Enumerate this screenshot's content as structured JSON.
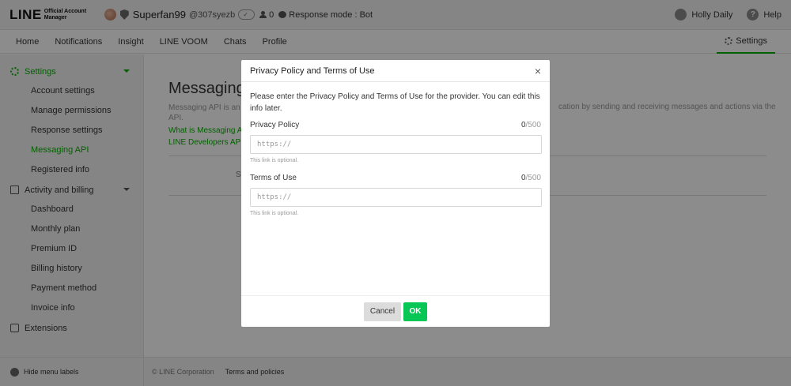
{
  "header": {
    "logo_main": "LINE",
    "logo_sub": "Official Account Manager",
    "account_name": "Superfan99",
    "account_id": "@307syezb",
    "badge": " ",
    "friends_count": "0",
    "response_mode": "Response mode : Bot",
    "user_name": "Holly Daily",
    "help_label": "Help"
  },
  "nav": {
    "tabs": [
      {
        "label": "Home"
      },
      {
        "label": "Notifications"
      },
      {
        "label": "Insight"
      },
      {
        "label": "LINE VOOM"
      },
      {
        "label": "Chats"
      },
      {
        "label": "Profile"
      }
    ],
    "settings_label": "Settings"
  },
  "sidebar": {
    "settings_group": "Settings",
    "settings_items": [
      {
        "label": "Account settings"
      },
      {
        "label": "Manage permissions"
      },
      {
        "label": "Response settings"
      },
      {
        "label": "Messaging API"
      },
      {
        "label": "Registered info"
      }
    ],
    "billing_group": "Activity and billing",
    "billing_items": [
      {
        "label": "Dashboard"
      },
      {
        "label": "Monthly plan"
      },
      {
        "label": "Premium ID"
      },
      {
        "label": "Billing history"
      },
      {
        "label": "Payment method"
      },
      {
        "label": "Invoice info"
      }
    ],
    "extensions_group": "Extensions",
    "hide_labels": "Hide menu labels"
  },
  "footer": {
    "copyright": "© LINE Corporation",
    "terms": "Terms and policies"
  },
  "main": {
    "title": "Messaging",
    "desc_left": "Messaging API is an",
    "desc_left2": "API.",
    "desc_right": "cation by sending and receiving messages and actions via the",
    "link1": "What is Messaging A",
    "link2": "LINE Developers API",
    "status_prefix": "St"
  },
  "modal": {
    "title": "Privacy Policy and Terms of Use",
    "close": "×",
    "intro": "Please enter the Privacy Policy and Terms of Use for the provider. You can edit this info later.",
    "privacy_label": "Privacy Policy",
    "privacy_count": "0",
    "privacy_max": "/500",
    "privacy_placeholder": "https://",
    "privacy_hint": "This link is optional.",
    "terms_label": "Terms of Use",
    "terms_count": "0",
    "terms_max": "/500",
    "terms_placeholder": "https://",
    "terms_hint": "This link is optional.",
    "cancel_label": "Cancel",
    "ok_label": "OK"
  },
  "colors": {
    "accent": "#06b000",
    "ok_button": "#06c755"
  }
}
